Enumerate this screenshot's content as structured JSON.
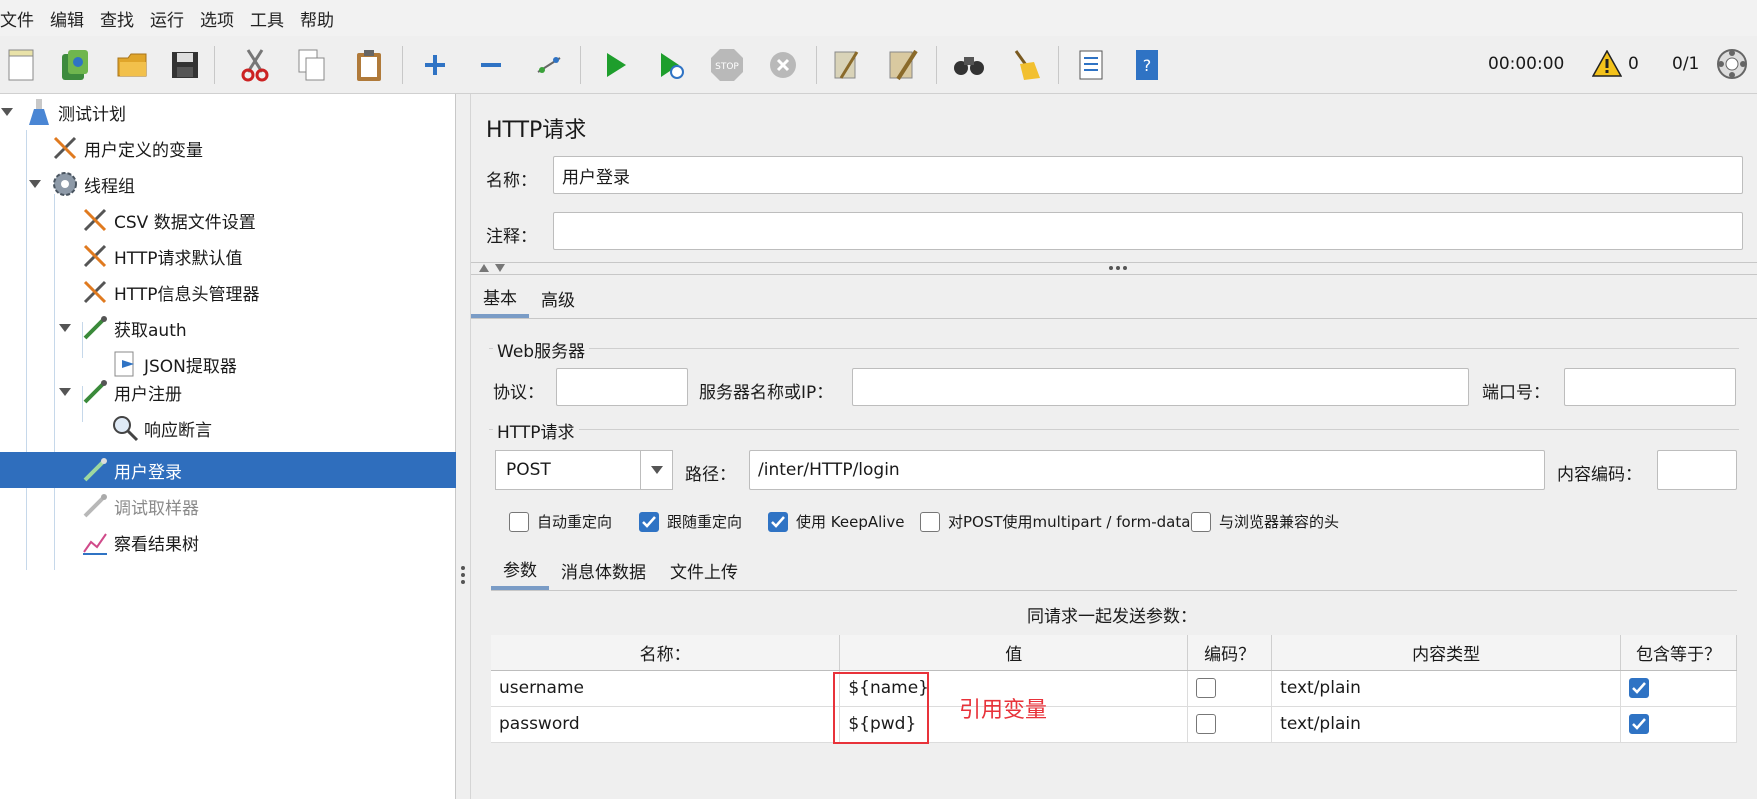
{
  "menu": [
    "文件",
    "编辑",
    "查找",
    "运行",
    "选项",
    "工具",
    "帮助"
  ],
  "toolbar": {
    "timer": "00:00:00",
    "warnings": "0",
    "threads": "0/1"
  },
  "tree": {
    "root": "测试计划",
    "user_vars": "用户定义的变量",
    "thread_group": "线程组",
    "csv": "CSV 数据文件设置",
    "http_defaults": "HTTP请求默认值",
    "header_mgr": "HTTP信息头管理器",
    "get_auth": "获取auth",
    "json_extractor": "JSON提取器",
    "register": "用户注册",
    "assertion": "响应断言",
    "login": "用户登录",
    "debug_sampler": "调试取样器",
    "result_tree": "察看结果树"
  },
  "panel": {
    "title": "HTTP请求",
    "name_label": "名称：",
    "name_value": "用户登录",
    "comment_label": "注释：",
    "comment_value": "",
    "tabs": [
      "基本",
      "高级"
    ],
    "web_server_title": "Web服务器",
    "protocol_label": "协议：",
    "protocol_value": "",
    "server_label": "服务器名称或IP：",
    "server_value": "",
    "port_label": "端口号：",
    "port_value": "",
    "http_request_title": "HTTP请求",
    "method": "POST",
    "path_label": "路径：",
    "path_value": "/inter/HTTP/login",
    "encoding_label": "内容编码：",
    "encoding_value": "",
    "options": [
      {
        "label": "自动重定向",
        "checked": false
      },
      {
        "label": "跟随重定向",
        "checked": true
      },
      {
        "label": "使用 KeepAlive",
        "checked": true
      },
      {
        "label": "对POST使用multipart / form-data",
        "checked": false
      },
      {
        "label": "与浏览器兼容的头",
        "checked": false
      }
    ],
    "sub_tabs": [
      "参数",
      "消息体数据",
      "文件上传"
    ],
    "params_caption": "同请求一起发送参数：",
    "columns": [
      "名称：",
      "值",
      "编码？",
      "内容类型",
      "包含等于？"
    ],
    "rows": [
      {
        "name": "username",
        "value": "${name}",
        "encode": false,
        "content_type": "text/plain",
        "include_equals": true
      },
      {
        "name": "password",
        "value": "${pwd}",
        "encode": false,
        "content_type": "text/plain",
        "include_equals": true
      }
    ],
    "annotation": "引用变量"
  },
  "colors": {
    "selection": "#2f6ebd",
    "checkbox_on": "#2f73c4",
    "annotation": "#e8323a"
  }
}
